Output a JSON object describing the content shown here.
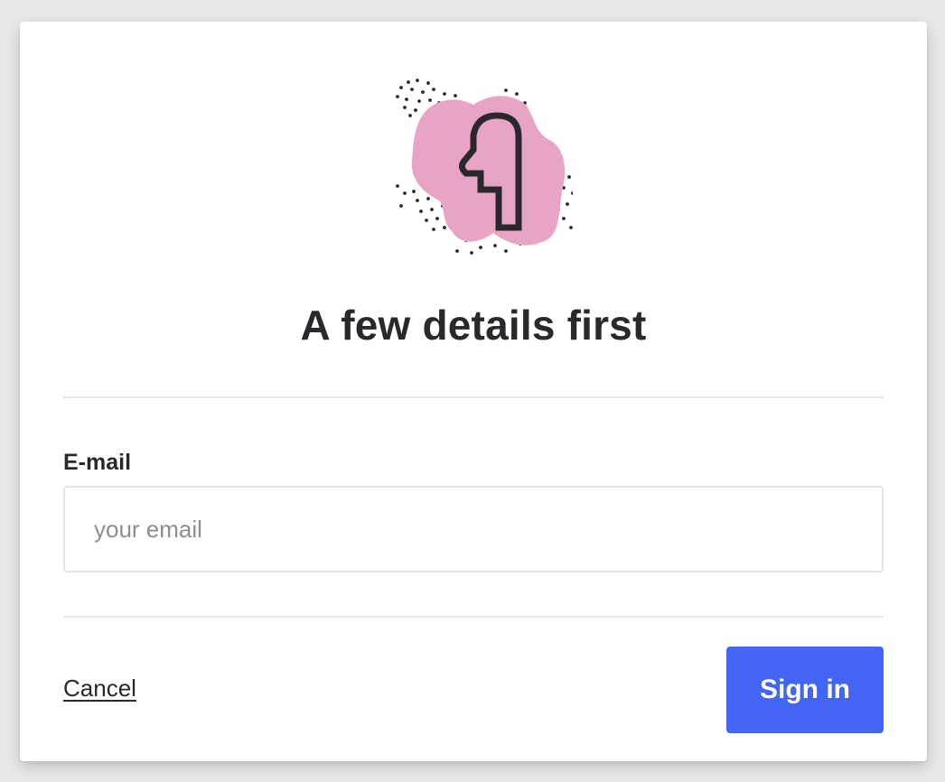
{
  "dialog": {
    "title": "A few details first",
    "illustration": {
      "icon": "head-profile-icon",
      "blob_color": "#e8a4c4",
      "stroke_color": "#2a282c"
    }
  },
  "form": {
    "email_label": "E-mail",
    "email_placeholder": "your email",
    "email_value": ""
  },
  "actions": {
    "cancel_label": "Cancel",
    "signin_label": "Sign in"
  },
  "colors": {
    "accent": "#4265f6",
    "text": "#2a282c",
    "background": "#e8e8e8",
    "card": "#ffffff"
  }
}
